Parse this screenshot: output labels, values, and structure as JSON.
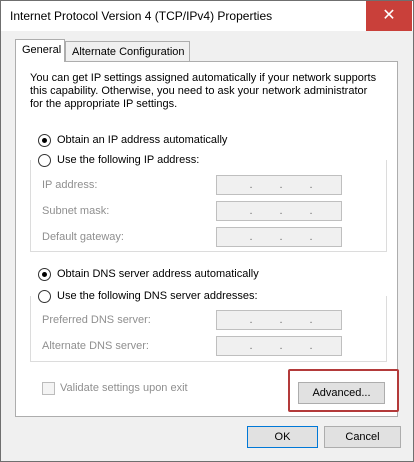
{
  "window": {
    "title": "Internet Protocol Version 4 (TCP/IPv4) Properties",
    "close_glyph": "✕"
  },
  "tabs": [
    {
      "label": "General",
      "active": true
    },
    {
      "label": "Alternate Configuration",
      "active": false
    }
  ],
  "intro_lines": [
    "You can get IP settings assigned automatically if your network supports",
    "this capability. Otherwise, you need to ask your network administrator",
    "for the appropriate IP settings."
  ],
  "ip_section": {
    "auto_option": {
      "label": "Obtain an IP address automatically",
      "checked": true
    },
    "manual_option": {
      "label": "Use the following IP address:",
      "checked": false
    },
    "fields": [
      {
        "label": "IP address:",
        "value": ". . ."
      },
      {
        "label": "Subnet mask:",
        "value": ". . ."
      },
      {
        "label": "Default gateway:",
        "value": ". . ."
      }
    ]
  },
  "dns_section": {
    "auto_option": {
      "label": "Obtain DNS server address automatically",
      "checked": true
    },
    "manual_option": {
      "label": "Use the following DNS server addresses:",
      "checked": false
    },
    "fields": [
      {
        "label": "Preferred DNS server:",
        "value": ". . ."
      },
      {
        "label": "Alternate DNS server:",
        "value": ". . ."
      }
    ]
  },
  "validate": {
    "label": "Validate settings upon exit",
    "checked": false
  },
  "buttons": {
    "advanced": "Advanced...",
    "ok": "OK",
    "cancel": "Cancel"
  },
  "colors": {
    "close_button": "#c9403a",
    "highlight_border": "#b33a3a",
    "default_button_border": "#0078d7"
  }
}
